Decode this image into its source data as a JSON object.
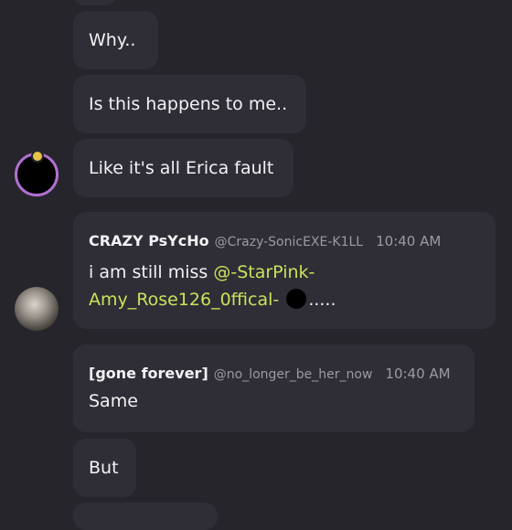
{
  "messages": {
    "m1": "Why..",
    "m2": "Is this happens to me..",
    "m3": "Like it's all Erica fault",
    "m4": {
      "name": "CRAZY PsYcHo",
      "handle": "@Crazy-SonicEXE-K1LL",
      "time": "10:40 AM",
      "text_before": "i am still miss ",
      "mention_line1": "@-StarPink-",
      "mention_line2": "Amy_Rose126_0ffical-",
      "text_after": "....."
    },
    "m5": {
      "name": "[gone forever]",
      "handle": "@no_longer_be_her_now",
      "time": "10:40 AM",
      "text": "Same"
    },
    "m6": "But"
  },
  "colors": {
    "background": "#26252c",
    "bubble": "#2f2e36",
    "mention": "#c8e35a",
    "avatar_ring": "#b070d0"
  }
}
